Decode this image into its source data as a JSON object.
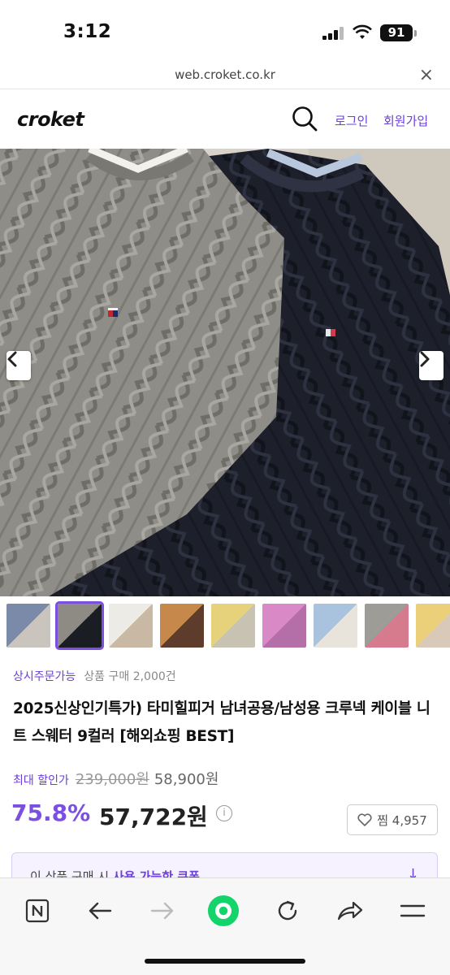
{
  "status_bar": {
    "time": "3:12",
    "battery": "91"
  },
  "browser": {
    "url": "web.croket.co.kr",
    "close_glyph": "×"
  },
  "header": {
    "logo": "croket",
    "login": "로그인",
    "signup": "회원가입"
  },
  "product": {
    "tag_pill": "상시주문가능",
    "sales": "상품 구매 2,000건",
    "title": "2025신상인기특가) 타미힐피거 남녀공용/남성용 크루넥 케이블 니트 스웨터 9컬러 [해외쇼핑 BEST]",
    "max_discount_label": "최대 할인가",
    "original_price": "239,000원",
    "sale_price": "58,900원",
    "discount_rate": "75.8%",
    "final_price": "57,722원",
    "info_glyph": "i",
    "wish_label": "찜 4,957"
  },
  "coupon": {
    "text_prefix": "이 상품 구매 시",
    "text_highlight": "사용 가능한 쿠폰",
    "arrow": "↓"
  },
  "thumbnails": [
    {
      "name": "thumb-1",
      "colors": [
        "#7a8aa8",
        "#c9c5be"
      ]
    },
    {
      "name": "thumb-2",
      "colors": [
        "#8e8b84",
        "#1b1d24"
      ],
      "active": true
    },
    {
      "name": "thumb-3",
      "colors": [
        "#ecebe6",
        "#c9b9a4"
      ]
    },
    {
      "name": "thumb-4",
      "colors": [
        "#c7884c",
        "#5e3c2c"
      ]
    },
    {
      "name": "thumb-5",
      "colors": [
        "#e6d27a",
        "#c8c2b3"
      ]
    },
    {
      "name": "thumb-6",
      "colors": [
        "#d889c6",
        "#b46fa9"
      ]
    },
    {
      "name": "thumb-7",
      "colors": [
        "#a9c3de",
        "#e8e4dc"
      ]
    },
    {
      "name": "thumb-8",
      "colors": [
        "#9e9c96",
        "#d67a8d"
      ]
    },
    {
      "name": "thumb-9",
      "colors": [
        "#ebd079",
        "#d8c9b8"
      ]
    }
  ],
  "colors": {
    "accent": "#7b4fe0",
    "link": "#6b3fd9",
    "sweater_grey": "#8d8b85",
    "sweater_navy": "#1c1f2a"
  }
}
